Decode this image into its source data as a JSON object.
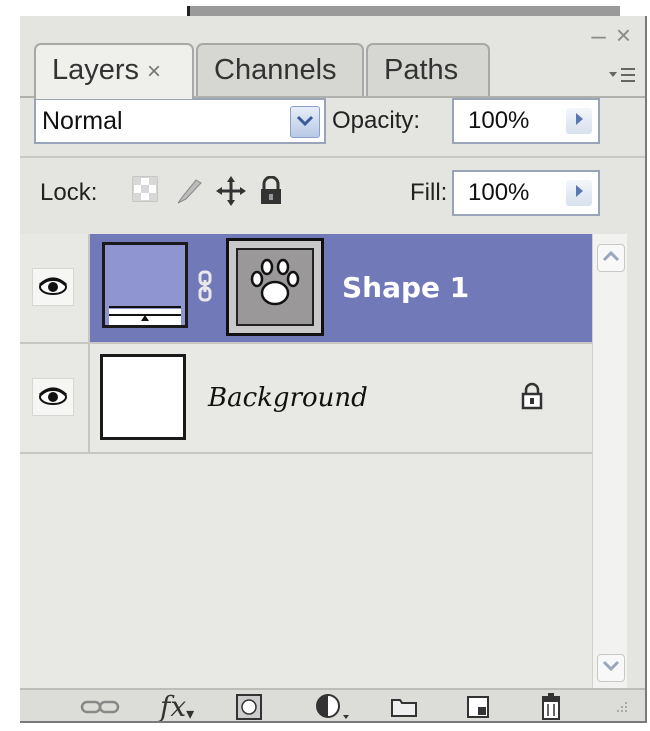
{
  "window_controls": {
    "minimize": "–",
    "close": "×"
  },
  "tabs": [
    {
      "label": "Layers",
      "close": "×",
      "active": true
    },
    {
      "label": "Channels",
      "active": false
    },
    {
      "label": "Paths",
      "active": false
    }
  ],
  "panel_menu_icon": "panel-menu-icon",
  "blend_mode": {
    "value": "Normal",
    "dropdown_icon": "chevron-down-icon"
  },
  "opacity": {
    "label": "Opacity:",
    "value": "100%"
  },
  "lock": {
    "label": "Lock:",
    "icons": [
      "lock-transparent-icon",
      "lock-image-icon",
      "lock-position-icon",
      "lock-all-icon"
    ]
  },
  "fill": {
    "label": "Fill:",
    "value": "100%"
  },
  "layers": [
    {
      "name": "Shape 1",
      "selected": true,
      "visible": true,
      "thumbnail_color": "#8f95d0",
      "mask_icon": "paw-print-icon"
    },
    {
      "name": "Background",
      "selected": false,
      "visible": true,
      "locked": true
    }
  ],
  "colors": {
    "selection": "#7279b9",
    "panel_bg": "#e4e4e0"
  },
  "bottom_toolbar": [
    "link-layers-icon",
    "fx-icon",
    "add-mask-icon",
    "adjustment-layer-icon",
    "new-group-icon",
    "new-layer-icon",
    "trash-icon"
  ],
  "fx_label": "fx"
}
